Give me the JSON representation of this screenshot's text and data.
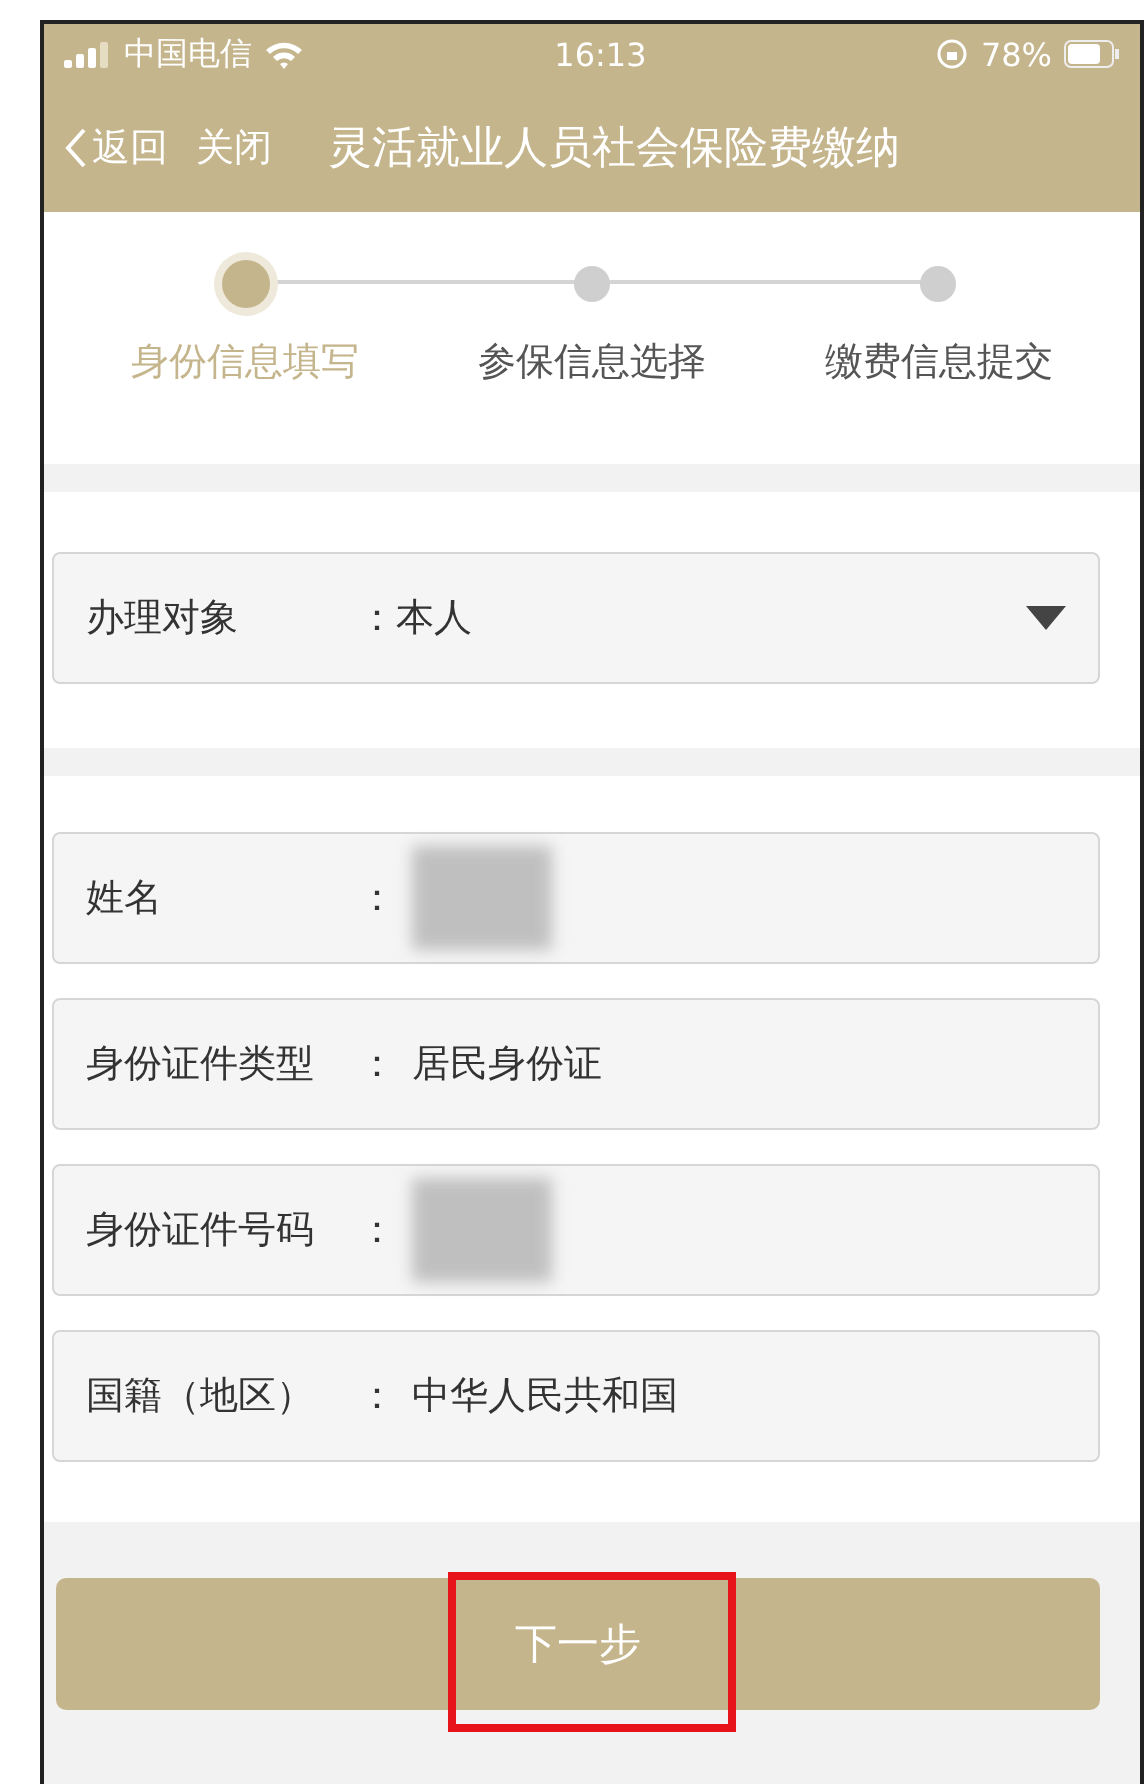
{
  "status_bar": {
    "carrier": "中国电信",
    "time": "16:13",
    "battery": "78%"
  },
  "nav": {
    "back": "返回",
    "close": "关闭",
    "title": "灵活就业人员社会保险费缴纳"
  },
  "steps": [
    {
      "label": "身份信息填写",
      "selected": true
    },
    {
      "label": "参保信息选择",
      "selected": false
    },
    {
      "label": "缴费信息提交",
      "selected": false
    }
  ],
  "select": {
    "label": "办理对象",
    "separator": "：",
    "value": "本人"
  },
  "fields": [
    {
      "label": "姓名",
      "separator": "：",
      "redacted": true
    },
    {
      "label": "身份证件类型",
      "separator": "：",
      "value": "居民身份证",
      "redacted": false
    },
    {
      "label": "身份证件号码",
      "separator": "：",
      "redacted": true
    },
    {
      "label": "国籍（地区）",
      "separator": "：",
      "value": "中华人民共和国",
      "redacted": false
    }
  ],
  "next_button": {
    "label": "下一步",
    "highlighted": true
  }
}
